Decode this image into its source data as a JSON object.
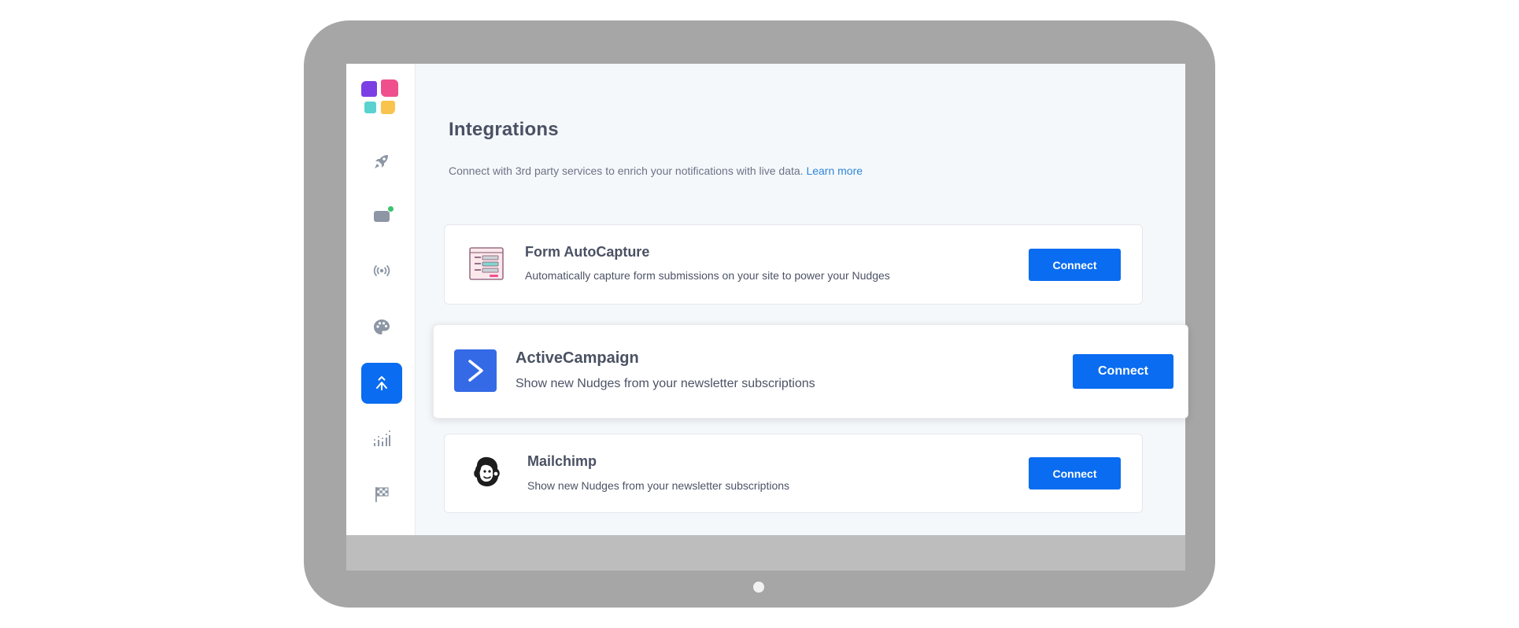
{
  "colors": {
    "frame": "#a6a6a6",
    "accent": "#0a6cf0",
    "link": "#2f86d9",
    "logo": [
      "#7b3fe4",
      "#ef4f8c",
      "#5ad2cf",
      "#f8c44d"
    ]
  },
  "sidebar": {
    "items": [
      {
        "icon": "rocket-icon"
      },
      {
        "icon": "notification-icon",
        "badge": true
      },
      {
        "icon": "broadcast-icon"
      },
      {
        "icon": "palette-icon"
      },
      {
        "icon": "integrations-icon",
        "active": true
      },
      {
        "icon": "analytics-icon"
      },
      {
        "icon": "flag-icon"
      }
    ]
  },
  "header": {
    "title": "Integrations",
    "subtitle": "Connect with 3rd party services to enrich your notifications with live data.",
    "learn_more": "Learn more"
  },
  "integrations": [
    {
      "name": "Form AutoCapture",
      "description": "Automatically capture form submissions on your site to power your Nudges",
      "button": "Connect",
      "icon": "form-icon"
    },
    {
      "name": "ActiveCampaign",
      "description": "Show new Nudges from your newsletter subscriptions",
      "button": "Connect",
      "icon": "activecampaign-icon"
    },
    {
      "name": "Mailchimp",
      "description": "Show new Nudges from your newsletter subscriptions",
      "button": "Connect",
      "icon": "mailchimp-icon"
    }
  ]
}
